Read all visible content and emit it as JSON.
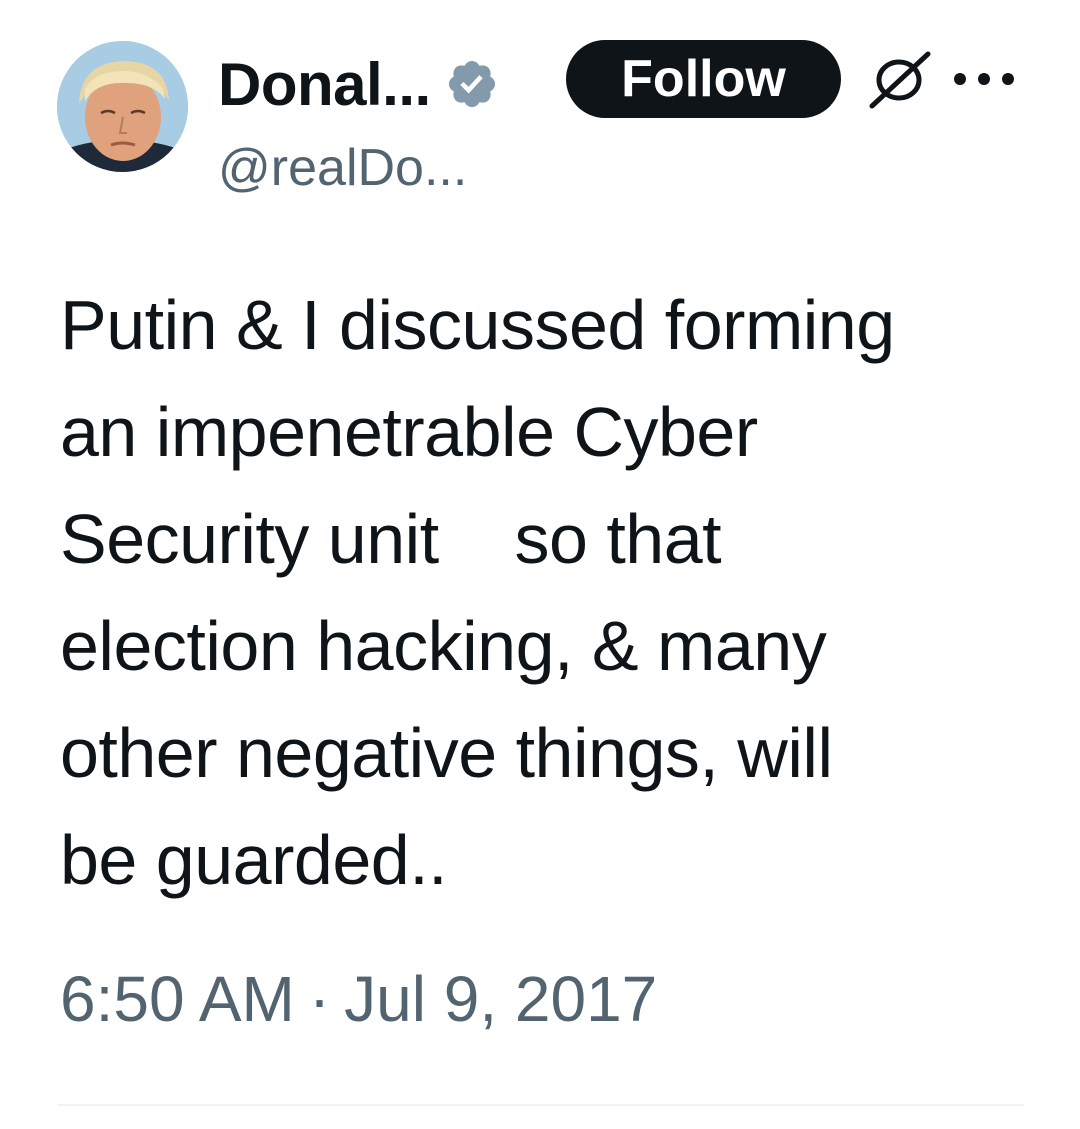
{
  "author": {
    "display_name": "Donal...",
    "handle": "@realDo...",
    "verified": true,
    "avatar_icon": "avatar-photo"
  },
  "actions": {
    "follow_label": "Follow",
    "grok_icon": "grok-icon",
    "more_icon": "more-icon"
  },
  "tweet": {
    "lines": [
      "Putin & I discussed forming",
      "an impenetrable Cyber",
      "Security unit    so that",
      "election hacking, & many",
      "other negative things, will",
      "be guarded.."
    ]
  },
  "meta": {
    "time": "6:50 AM",
    "separator": "·",
    "date": "Jul 9, 2017"
  },
  "colors": {
    "text": "#0f1419",
    "secondary": "#536471",
    "verified_badge": "#829aab",
    "follow_bg": "#0f1419"
  }
}
